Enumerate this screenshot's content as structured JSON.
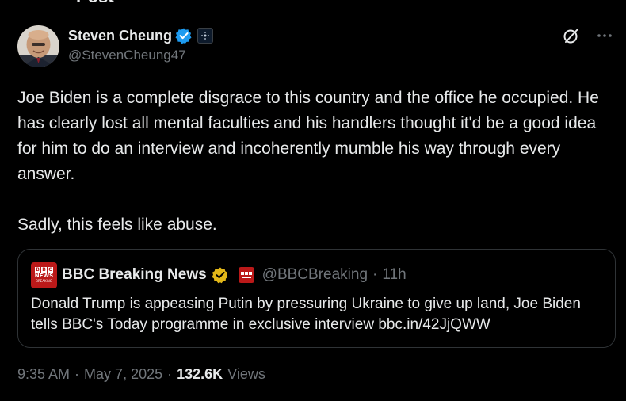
{
  "header": {
    "title": "Post"
  },
  "author": {
    "display_name": "Steven Cheung",
    "handle": "@StevenCheung47",
    "verified_color": "#1d9bf0"
  },
  "tweet": {
    "text": "Joe Biden is a complete disgrace to this country and the office he occupied. He has clearly lost all mental faculties and his handlers thought it'd be a good idea for him to do an interview and incoherently mumble his way through every answer.\n\nSadly, this feels like abuse."
  },
  "quote": {
    "display_name": "BBC Breaking News",
    "handle": "@BBCBreaking",
    "separator": "·",
    "time": "11h",
    "text": "Donald Trump is appeasing Putin by pressuring Ukraine to give up land, Joe Biden tells BBC's Today programme in exclusive interview bbc.in/42JjQWW",
    "logo_text": {
      "bbc": [
        "B",
        "B",
        "C"
      ],
      "news": "NEWS",
      "breaking": "BREAKING"
    },
    "brand_color": "#bb1919",
    "badge_color": "#e2b719"
  },
  "meta": {
    "time": "9:35 AM",
    "separator": "·",
    "date": "May 7, 2025",
    "views_count": "132.6K",
    "views_label": "Views"
  },
  "icons": {
    "grok": "grok-icon",
    "more": "more-icon"
  }
}
